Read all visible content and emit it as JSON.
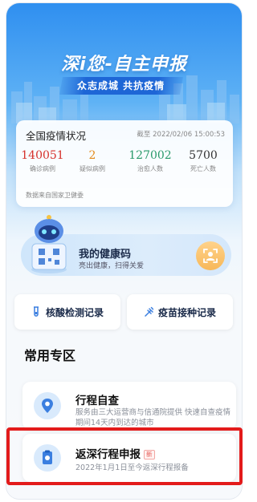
{
  "header": {
    "title": "深i您-自主申报",
    "banner": "众志成城 共抗疫情"
  },
  "stats": {
    "title": "全国疫情状况",
    "timestamp": "截至 2022/02/06 15:00:53",
    "items": [
      {
        "value": "140051",
        "label": "确诊病例",
        "color": "#d6312b"
      },
      {
        "value": "2",
        "label": "疑似病例",
        "color": "#e38a1c"
      },
      {
        "value": "127002",
        "label": "治愈人数",
        "color": "#2a9a6a"
      },
      {
        "value": "5700",
        "label": "死亡人数",
        "color": "#333333"
      }
    ],
    "source": "数据来自国家卫健委"
  },
  "health_code": {
    "title": "我的健康码",
    "subtitle": "亮出健康，扫得关爱",
    "icon": "face-scan-icon"
  },
  "records": {
    "nucleic_label": "核酸检测记录",
    "vaccine_label": "疫苗接种记录"
  },
  "section": {
    "title": "常用专区"
  },
  "services": [
    {
      "title": "行程自查",
      "desc": "服务由三大运营商与信通院提供 快速自查疫情期间14天内到达的城市",
      "icon": "location-pin-icon"
    },
    {
      "title": "返深行程申报",
      "badge": "新",
      "desc": "2022年1月1日至今返深行程报备",
      "icon": "clipboard-icon"
    }
  ]
}
